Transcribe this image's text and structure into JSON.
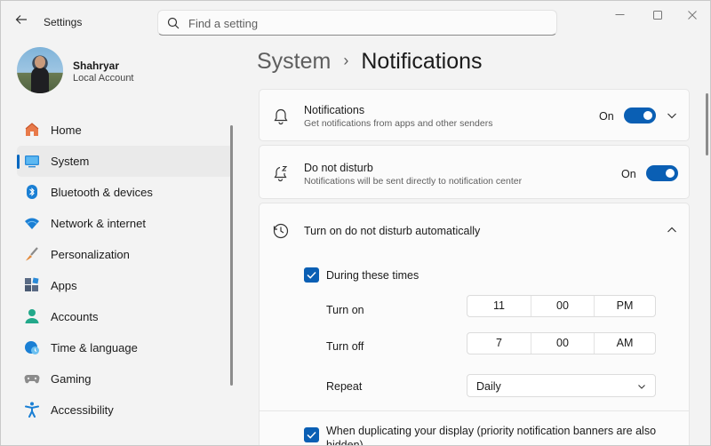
{
  "window": {
    "title": "Settings"
  },
  "search": {
    "placeholder": "Find a setting"
  },
  "user": {
    "name": "Shahryar",
    "account_type": "Local Account"
  },
  "sidebar": {
    "items": [
      {
        "label": "Home",
        "icon": "home-icon"
      },
      {
        "label": "System",
        "icon": "system-icon",
        "active": true
      },
      {
        "label": "Bluetooth & devices",
        "icon": "bluetooth-icon"
      },
      {
        "label": "Network & internet",
        "icon": "wifi-icon"
      },
      {
        "label": "Personalization",
        "icon": "brush-icon"
      },
      {
        "label": "Apps",
        "icon": "apps-icon"
      },
      {
        "label": "Accounts",
        "icon": "accounts-icon"
      },
      {
        "label": "Time & language",
        "icon": "globe-clock-icon"
      },
      {
        "label": "Gaming",
        "icon": "gamepad-icon"
      },
      {
        "label": "Accessibility",
        "icon": "accessibility-icon"
      }
    ]
  },
  "breadcrumb": {
    "parent": "System",
    "separator": "›",
    "current": "Notifications"
  },
  "notifications": {
    "title": "Notifications",
    "description": "Get notifications from apps and other senders",
    "state": "On"
  },
  "dnd": {
    "title": "Do not disturb",
    "description": "Notifications will be sent directly to notification center",
    "state": "On"
  },
  "auto_dnd": {
    "title": "Turn on do not disturb automatically",
    "during_times_label": "During these times",
    "turn_on": {
      "label": "Turn on",
      "hour": "11",
      "minute": "00",
      "period": "PM"
    },
    "turn_off": {
      "label": "Turn off",
      "hour": "7",
      "minute": "00",
      "period": "AM"
    },
    "repeat": {
      "label": "Repeat",
      "value": "Daily"
    },
    "duplicating_label": "When duplicating your display (priority notification banners are also hidden)"
  },
  "colors": {
    "accent": "#0a5fb4",
    "background": "#f3f3f3",
    "card": "#fbfbfb"
  }
}
